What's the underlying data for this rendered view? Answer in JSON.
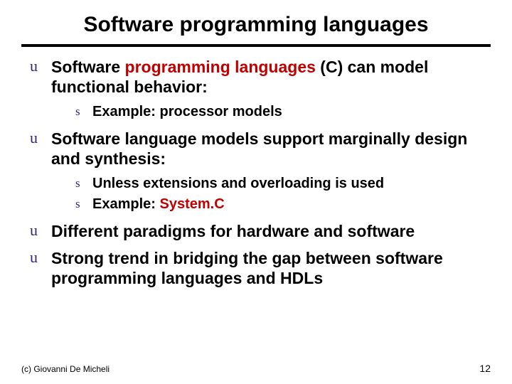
{
  "title": "Software programming languages",
  "bullets": {
    "b1_pre": "Software ",
    "b1_em": "programming languages",
    "b1_post": " (C)  can model functional behavior:",
    "b1_s1": "Example: processor models",
    "b2": "Software language models support marginally design and synthesis:",
    "b2_s1": "Unless extensions and overloading is used",
    "b2_s2_pre": "Example: ",
    "b2_s2_em": "System.C",
    "b3": "Different paradigms for hardware and software",
    "b4": "Strong trend in bridging the gap between software programming languages and HDLs"
  },
  "footer": "(c)  Giovanni De Micheli",
  "page_number": "12"
}
